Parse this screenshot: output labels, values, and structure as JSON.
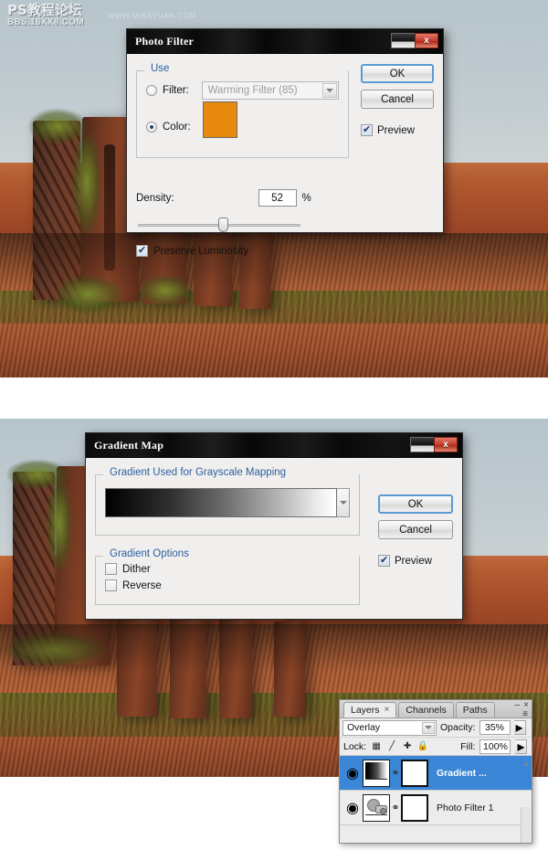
{
  "watermark": {
    "line1": "PS教程论坛",
    "line2": "BBS.16XX8.COM",
    "line3": "WWW.MISSYUAN.COM"
  },
  "photo_filter_dialog": {
    "title": "Photo Filter",
    "minimize_label": "–",
    "close_label": "x",
    "use_legend": "Use",
    "filter_label": "Filter:",
    "filter_value": "Warming Filter (85)",
    "filter_selected": false,
    "color_label": "Color:",
    "color_selected": true,
    "color_value": "#e8890f",
    "density_label": "Density:",
    "density_value": "52",
    "density_unit": "%",
    "density_percent": 52,
    "preserve_luminosity_label": "Preserve Luminosity",
    "preserve_luminosity_checked": true,
    "ok_label": "OK",
    "cancel_label": "Cancel",
    "preview_label": "Preview",
    "preview_checked": true
  },
  "gradient_map_dialog": {
    "title": "Gradient Map",
    "minimize_label": "–",
    "close_label": "x",
    "mapping_legend": "Gradient Used for Grayscale Mapping",
    "gradient_start_color": "#000000",
    "gradient_end_color": "#ffffff",
    "options_legend": "Gradient Options",
    "dither_label": "Dither",
    "dither_checked": false,
    "reverse_label": "Reverse",
    "reverse_checked": false,
    "ok_label": "OK",
    "cancel_label": "Cancel",
    "preview_label": "Preview",
    "preview_checked": true
  },
  "layers_panel": {
    "tabs": [
      {
        "label": "Layers",
        "active": true,
        "closable": true
      },
      {
        "label": "Channels",
        "active": false,
        "closable": false
      },
      {
        "label": "Paths",
        "active": false,
        "closable": false
      }
    ],
    "tab_close_glyph": "×",
    "minimize_glyph": "–",
    "close_glyph": "×",
    "menu_glyph": "≡",
    "blend_mode": "Overlay",
    "opacity_label": "Opacity:",
    "opacity_value": "35%",
    "lock_label": "Lock:",
    "lock_icons": [
      "transparency-lock",
      "brush-lock",
      "move-lock",
      "all-lock"
    ],
    "fill_label": "Fill:",
    "fill_value": "100%",
    "spinner_glyph": "▸",
    "eye_glyph": "◉",
    "link_glyph": "⚭",
    "scroll_up_glyph": "▲",
    "layers": [
      {
        "name": "Gradient ...",
        "selected": true,
        "visible": true,
        "thumb": "gradient-map-thumb"
      },
      {
        "name": "Photo Filter 1",
        "selected": false,
        "visible": true,
        "thumb": "photo-filter-thumb"
      }
    ]
  },
  "accent_colors": {
    "legend_blue": "#2c5f9e",
    "selection_blue": "#3b86d6",
    "titlebar_black": "#0d0d0d",
    "close_red": "#c23a28",
    "swatch_orange": "#e8890f"
  }
}
